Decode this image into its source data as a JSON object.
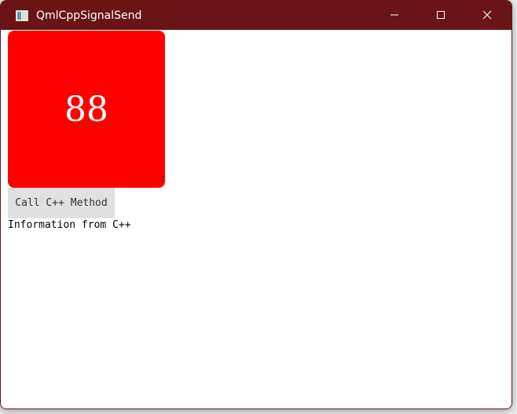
{
  "window": {
    "title": "QmlCppSignalSend",
    "titlebar_color": "#6b1416"
  },
  "controls": {
    "minimize_icon": "minimize-icon",
    "maximize_icon": "maximize-icon",
    "close_icon": "close-icon"
  },
  "content": {
    "box_value": "88",
    "box_color": "#ff0000",
    "button_label": "Call C++ Method",
    "info_text": "Information from C++"
  }
}
